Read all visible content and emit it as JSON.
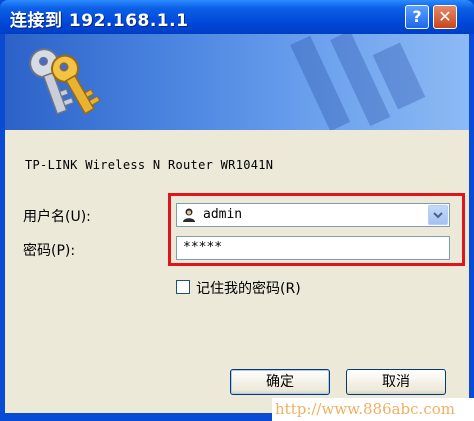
{
  "window": {
    "title": "连接到 192.168.1.1",
    "help_label": "?",
    "close_label": "✕"
  },
  "dialog": {
    "router_name": "TP-LINK Wireless N Router WR1041N",
    "username_label": "用户名(U):",
    "username_value": "admin",
    "password_label": "密码(P):",
    "password_value": "*****",
    "remember_label": "记住我的密码(R)",
    "remember_checked": false,
    "ok_label": "确定",
    "cancel_label": "取消"
  },
  "watermark": "http://www.886abc.com",
  "colors": {
    "titlebar": "#0046d8",
    "highlight": "#e0141b",
    "dialog_bg": "#ece9d8",
    "watermark": "#f0b060"
  },
  "icons": [
    "keys-icon",
    "help-icon",
    "close-icon",
    "user-icon",
    "dropdown-arrow-icon",
    "checkbox-icon"
  ]
}
